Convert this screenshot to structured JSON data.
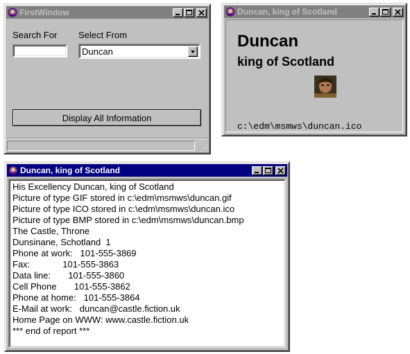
{
  "first_window": {
    "title": "FirstWindow",
    "search_label": "Search For",
    "search_value": "",
    "select_label": "Select From",
    "select_value": "Duncan",
    "display_button": "Display All Information"
  },
  "summary_window": {
    "title": "Duncan, king of Scotland",
    "name": "Duncan",
    "subtitle": "king of Scotland",
    "icon_path": "c:\\edm\\msmws\\duncan.ico"
  },
  "report_window": {
    "title": "Duncan, king of Scotland",
    "lines": [
      "His Excellency Duncan, king of Scotland",
      "Picture of type GIF stored in c:\\edm\\msmws\\duncan.gif",
      "Picture of type ICO stored in c:\\edm\\msmws\\duncan.ico",
      "Picture of type BMP stored in c:\\edm\\msmws\\duncan.bmp",
      "The Castle, Throne",
      "Dunsinane, Schotland  1",
      "Phone at work:   101-555-3869",
      "Fax:             101-555-3863",
      "Data line:       101-555-3860",
      "Cell Phone       101-555-3862",
      "Phone at home:   101-555-3864",
      "E-Mail at work:   duncan@castle.fiction.uk",
      "Home Page on WWW: www.castle.fiction.uk",
      "*** end of report ***"
    ]
  },
  "colors": {
    "active_title": "#000080",
    "inactive_title": "#808080",
    "face": "#c0c0c0"
  }
}
